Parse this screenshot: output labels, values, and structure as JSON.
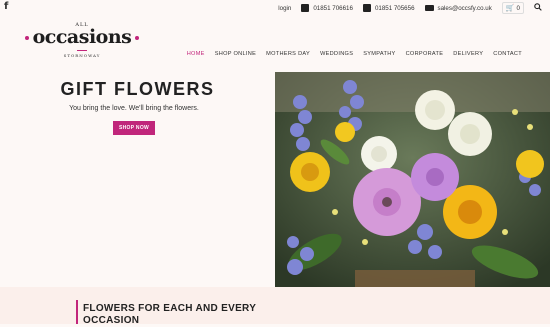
{
  "topbar": {
    "facebook_icon": "facebook-icon",
    "login_label": "login",
    "phone1": "01851 706616",
    "phone2": "01851 705656",
    "email": "sales@occsfy.co.uk",
    "cart_count": "0"
  },
  "logo": {
    "top": "ALL",
    "main": "occasions",
    "town": "STORNOWAY",
    "accent_color": "#c2257b"
  },
  "nav": {
    "items": [
      "HOME",
      "SHOP ONLINE",
      "MOTHERS DAY",
      "WEDDINGS",
      "SYMPATHY",
      "CORPORATE",
      "DELIVERY",
      "CONTACT"
    ],
    "active_index": 0
  },
  "hero": {
    "title": "GIFT FLOWERS",
    "subtitle": "You bring the love. We'll bring the flowers.",
    "button_label": "SHOP NOW",
    "button_color": "#c0267b"
  },
  "section": {
    "title_line1": "FLOWERS FOR EACH AND EVERY",
    "title_line2": "OCCASION"
  }
}
